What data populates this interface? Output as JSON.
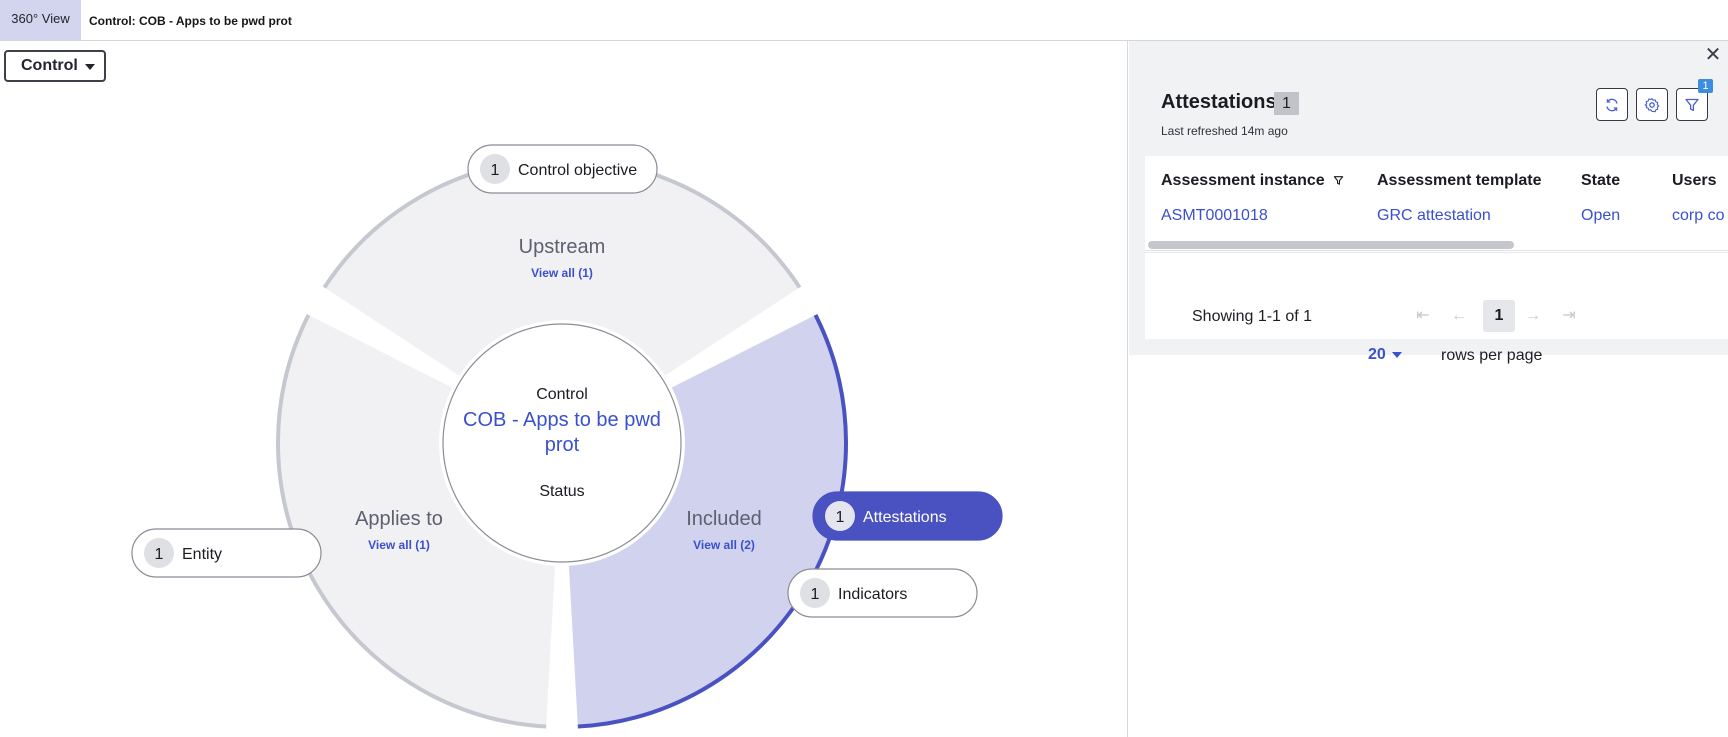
{
  "tabs": {
    "view_label": "360° View",
    "page_title": "Control: COB - Apps to be pwd prot"
  },
  "left": {
    "dropdown_label": "Control",
    "center": {
      "type_label": "Control",
      "name_lines": [
        "COB - Apps to be pwd",
        "prot"
      ],
      "status_label": "Status"
    },
    "sectors": [
      {
        "id": "upstream",
        "label": "Upstream",
        "link": "View all (1)",
        "highlighted": false
      },
      {
        "id": "applies",
        "label": "Applies to",
        "link": "View all (1)",
        "highlighted": false
      },
      {
        "id": "included",
        "label": "Included",
        "link": "View all (2)",
        "highlighted": true
      }
    ],
    "pills": [
      {
        "id": "control-objective",
        "label": "Control objective",
        "count": "1",
        "selected": false
      },
      {
        "id": "entity",
        "label": "Entity",
        "count": "1",
        "selected": false
      },
      {
        "id": "attestations",
        "label": "Attestations",
        "count": "1",
        "selected": true
      },
      {
        "id": "indicators",
        "label": "Indicators",
        "count": "1",
        "selected": false
      }
    ],
    "colors": {
      "sector_fill": "#f1f1f4",
      "sector_ring": "#c6c8d0",
      "highlight_fill": "#d1d3ee",
      "highlight_ring": "#4a52c1",
      "link": "#3a50cf",
      "pill_selected": "#4a52c1"
    }
  },
  "right": {
    "close_icon": "close-icon",
    "title": "Attestations",
    "count": "1",
    "last_refreshed": "Last refreshed 14m ago",
    "toolbar": {
      "refresh_icon": "refresh-icon",
      "settings_icon": "gear-icon",
      "filter_icon": "filter-icon",
      "filter_badge": "1"
    },
    "table": {
      "columns": [
        "Assessment instance",
        "Assessment template",
        "State",
        "Users"
      ],
      "rows": [
        [
          "ASMT0001018",
          "GRC attestation",
          "Open",
          "corp co"
        ]
      ]
    },
    "pagination": {
      "showing": "Showing 1-1 of 1",
      "current_page": "1",
      "rows_per_page_value": "20",
      "rows_per_page_label": "rows per page"
    }
  }
}
